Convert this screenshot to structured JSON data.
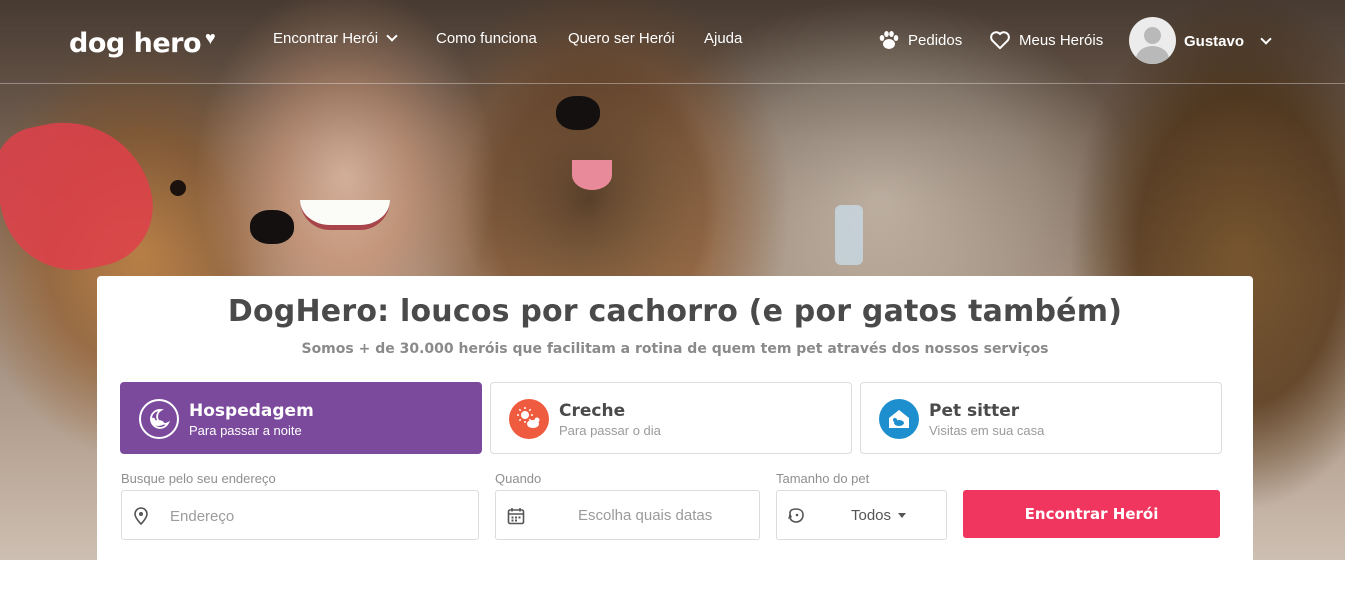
{
  "header": {
    "logo": "dog hero",
    "nav": {
      "find_hero": "Encontrar Herói",
      "how_it_works": "Como funciona",
      "become_hero": "Quero ser Herói",
      "help": "Ajuda"
    },
    "orders": "Pedidos",
    "my_heroes": "Meus Heróis",
    "user_name": "Gustavo"
  },
  "search": {
    "title": "DogHero: loucos por cachorro (e por gatos também)",
    "subtitle": "Somos + de 30.000 heróis que facilitam a rotina de quem tem pet através dos nossos serviços",
    "services": [
      {
        "title": "Hospedagem",
        "description": "Para passar a noite",
        "icon": "moon-dog-icon",
        "active": true
      },
      {
        "title": "Creche",
        "description": "Para passar o dia",
        "icon": "sun-dog-icon",
        "active": false
      },
      {
        "title": "Pet sitter",
        "description": "Visitas em sua casa",
        "icon": "house-dog-icon",
        "active": false
      }
    ],
    "address": {
      "label": "Busque pelo seu endereço",
      "placeholder": "Endereço"
    },
    "when": {
      "label": "Quando",
      "placeholder": "Escolha quais datas"
    },
    "pet_size": {
      "label": "Tamanho do pet",
      "value": "Todos"
    },
    "submit": "Encontrar Herói"
  },
  "colors": {
    "primary_purple": "#7b4a9c",
    "cta_pink": "#f0365f",
    "creche_orange": "#ef5b3e",
    "petsitter_blue": "#1d8fcf"
  }
}
